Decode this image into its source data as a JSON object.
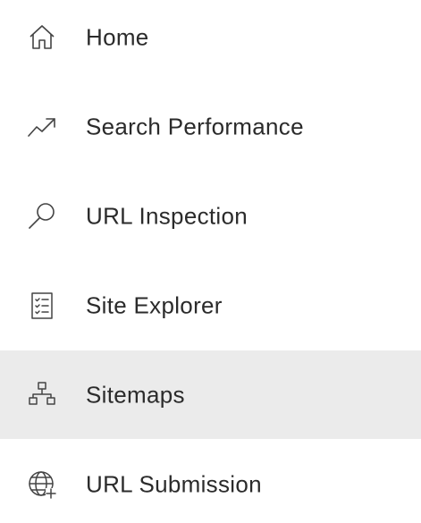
{
  "nav": {
    "items": [
      {
        "label": "Home",
        "icon": "home-icon",
        "active": false
      },
      {
        "label": "Search Performance",
        "icon": "trending-up-icon",
        "active": false
      },
      {
        "label": "URL Inspection",
        "icon": "search-icon",
        "active": false
      },
      {
        "label": "Site Explorer",
        "icon": "checklist-icon",
        "active": false
      },
      {
        "label": "Sitemaps",
        "icon": "sitemap-icon",
        "active": true
      },
      {
        "label": "URL Submission",
        "icon": "globe-add-icon",
        "active": false
      }
    ]
  },
  "colors": {
    "active_background": "#ebebeb",
    "text": "#2b2b2b",
    "icon": "#444444"
  }
}
